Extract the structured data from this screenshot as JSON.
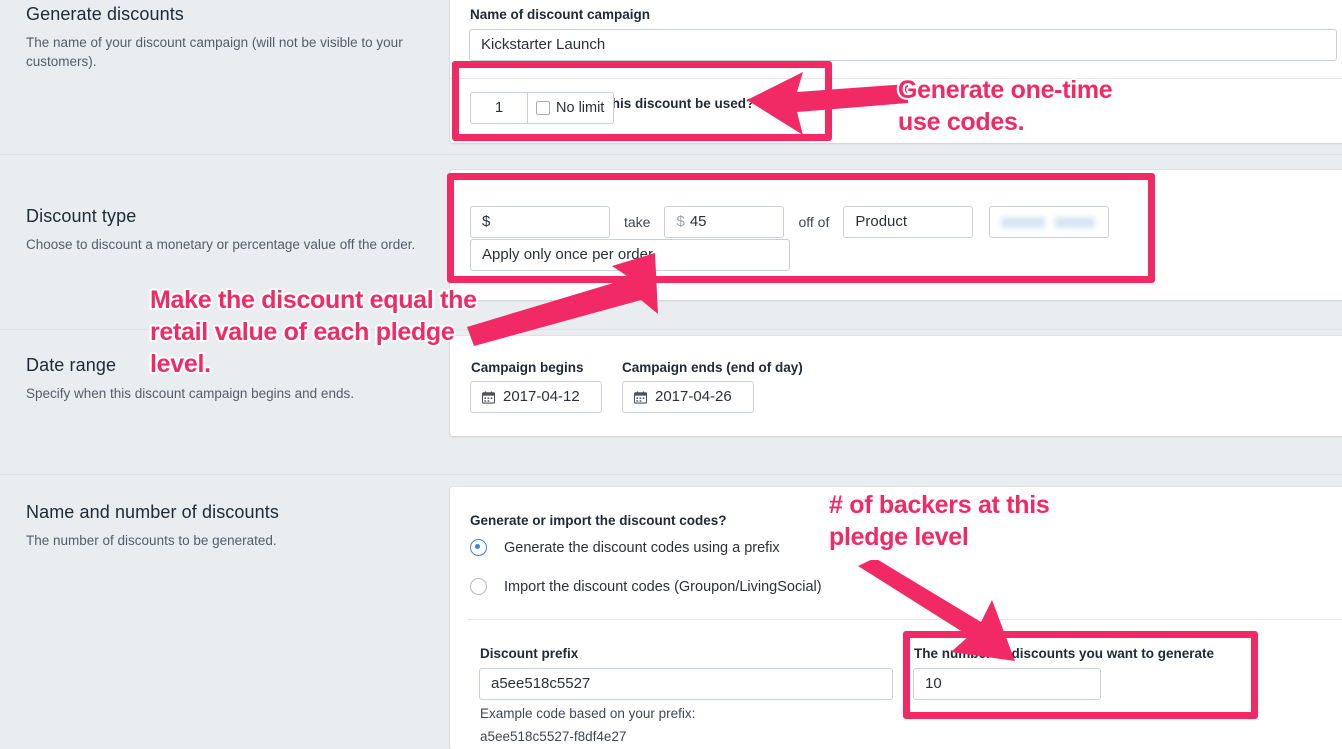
{
  "theme": {
    "accent_pink": "#f12a65",
    "page_bg": "#eaedf0",
    "card_bg": "#ffffff",
    "radio_blue": "#3d83d8"
  },
  "sections": {
    "generate_discounts": {
      "title": "Generate discounts",
      "description": "The name of your discount campaign (will not be visible to your customers).",
      "name_label": "Name of discount campaign",
      "name_value": "Kickstarter Launch",
      "uses_label": "How many times can this discount be used?",
      "uses_value": "1",
      "no_limit_label": "No limit"
    },
    "discount_type": {
      "title": "Discount type",
      "description": "Choose to discount a monetary or percentage value off the order.",
      "type_value": "$",
      "take_label": "take",
      "amount_prefix": "$",
      "amount_value": "45",
      "off_of_label": "off of",
      "target_value": "Product",
      "target_item_value": "",
      "apply_value": "Apply only once per order"
    },
    "date_range": {
      "title": "Date range",
      "description": "Specify when this discount campaign begins and ends.",
      "begins_label": "Campaign begins",
      "begins_value": "2017-04-12",
      "ends_label": "Campaign ends (end of day)",
      "ends_value": "2017-04-26"
    },
    "name_and_number": {
      "title": "Name and number of discounts",
      "description": "The number of discounts to be generated.",
      "mode_label": "Generate or import the discount codes?",
      "option_generate": "Generate the discount codes using a prefix",
      "option_import": "Import the discount codes (Groupon/LivingSocial)",
      "selected_option": "generate",
      "prefix_label": "Discount prefix",
      "prefix_value": "a5ee518c5527",
      "example_label": "Example code based on your prefix:",
      "example_value": "a5ee518c5527-f8df4e27",
      "count_label": "The number of discounts you want to generate",
      "count_value": "10"
    }
  },
  "annotations": [
    {
      "id": "one-time-use",
      "text": "Generate one-time\nuse codes."
    },
    {
      "id": "retail-value",
      "text": "Make the discount equal the\nretail value of each pledge\nlevel."
    },
    {
      "id": "backers-count",
      "text": "# of backers at this\npledge level"
    }
  ]
}
